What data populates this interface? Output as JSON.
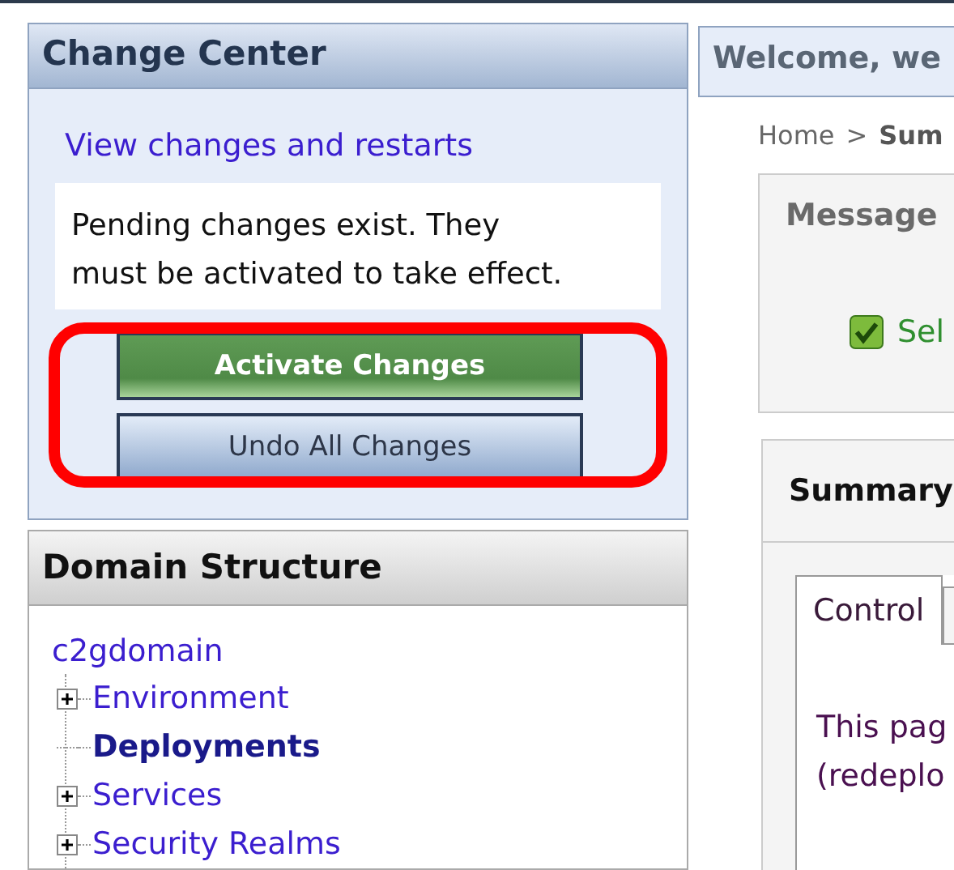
{
  "change_center": {
    "title": "Change Center",
    "link": "View changes and restarts",
    "message": "Pending changes exist. They must be activated to take effect.",
    "buttons": [
      {
        "label": "Activate Changes",
        "kind": "primary"
      },
      {
        "label": "Undo All Changes",
        "kind": "secondary"
      }
    ],
    "highlighted": true
  },
  "domain_structure": {
    "title": "Domain Structure",
    "root": "c2gdomain",
    "children": [
      {
        "label": "Environment",
        "kind": "group",
        "selected": false
      },
      {
        "label": "Deployments",
        "kind": "leaf",
        "selected": true
      },
      {
        "label": "Services",
        "kind": "group",
        "selected": false
      },
      {
        "label": "Security Realms",
        "kind": "group",
        "selected": false
      }
    ]
  },
  "welcome": "Welcome, we",
  "breadcrumb": [
    "Home",
    ">",
    "Sum"
  ],
  "messages": {
    "title": "Message",
    "items": [
      {
        "text": "Sel",
        "kind": "success"
      }
    ]
  },
  "summary": {
    "title": "Summary",
    "tabs": [
      {
        "label": "Control",
        "selected": true
      }
    ],
    "lines": [
      "This pag",
      "(redeplo"
    ]
  }
}
